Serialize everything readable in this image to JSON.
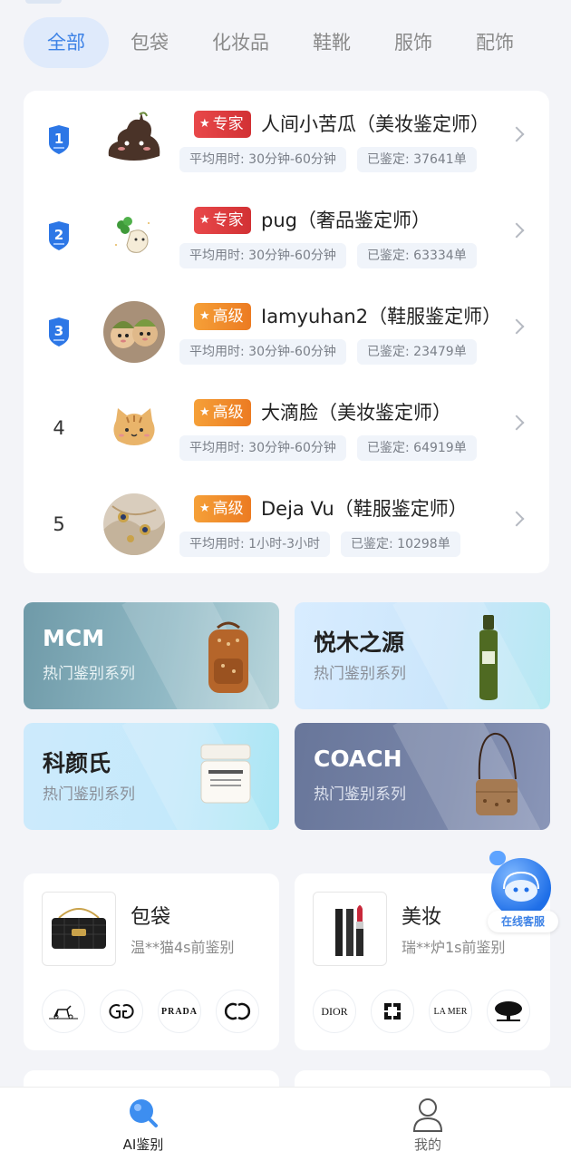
{
  "tabs": [
    {
      "label": "全部",
      "active": true
    },
    {
      "label": "包袋"
    },
    {
      "label": "化妆品"
    },
    {
      "label": "鞋靴"
    },
    {
      "label": "服饰"
    },
    {
      "label": "配饰"
    }
  ],
  "ranking": [
    {
      "rank": "1",
      "level": "专家",
      "level_type": "expert",
      "name": "人间小苦瓜（美妆鉴定师）",
      "avg_time": "平均用时: 30分钟-60分钟",
      "count": "已鉴定: 37641单"
    },
    {
      "rank": "2",
      "level": "专家",
      "level_type": "expert",
      "name": "pug（奢品鉴定师）",
      "avg_time": "平均用时: 30分钟-60分钟",
      "count": "已鉴定: 63334单"
    },
    {
      "rank": "3",
      "level": "高级",
      "level_type": "senior",
      "name": "Iamyuhan2（鞋服鉴定师）",
      "avg_time": "平均用时: 30分钟-60分钟",
      "count": "已鉴定: 23479单"
    },
    {
      "rank": "4",
      "level": "高级",
      "level_type": "senior",
      "name": "大滴脸（美妆鉴定师）",
      "avg_time": "平均用时: 30分钟-60分钟",
      "count": "已鉴定: 64919单"
    },
    {
      "rank": "5",
      "level": "高级",
      "level_type": "senior",
      "name": "Deja Vu（鞋服鉴定师）",
      "avg_time": "平均用时: 1小时-3小时",
      "count": "已鉴定: 10298单"
    }
  ],
  "series": [
    {
      "title": "MCM",
      "subtitle": "热门鉴别系列"
    },
    {
      "title": "悦木之源",
      "subtitle": "热门鉴别系列"
    },
    {
      "title": "科颜氏",
      "subtitle": "热门鉴别系列"
    },
    {
      "title": "COACH",
      "subtitle": "热门鉴别系列"
    }
  ],
  "categories": [
    {
      "title": "包袋",
      "subtitle": "温**猫4s前鉴别",
      "brands": [
        "hermes-logo",
        "gucci-logo",
        "PRADA",
        "chanel-logo"
      ]
    },
    {
      "title": "美妆",
      "subtitle": "瑞**炉1s前鉴别",
      "brands": [
        "DIOR",
        "givenchy-logo",
        "LA MER",
        "tree-logo"
      ]
    }
  ],
  "service_label": "在线客服",
  "nav": {
    "ai": "AI鉴别",
    "mine": "我的"
  },
  "colors": {
    "accent": "#3d82e6",
    "expert": "#e03c3e",
    "senior": "#f08a2a"
  }
}
